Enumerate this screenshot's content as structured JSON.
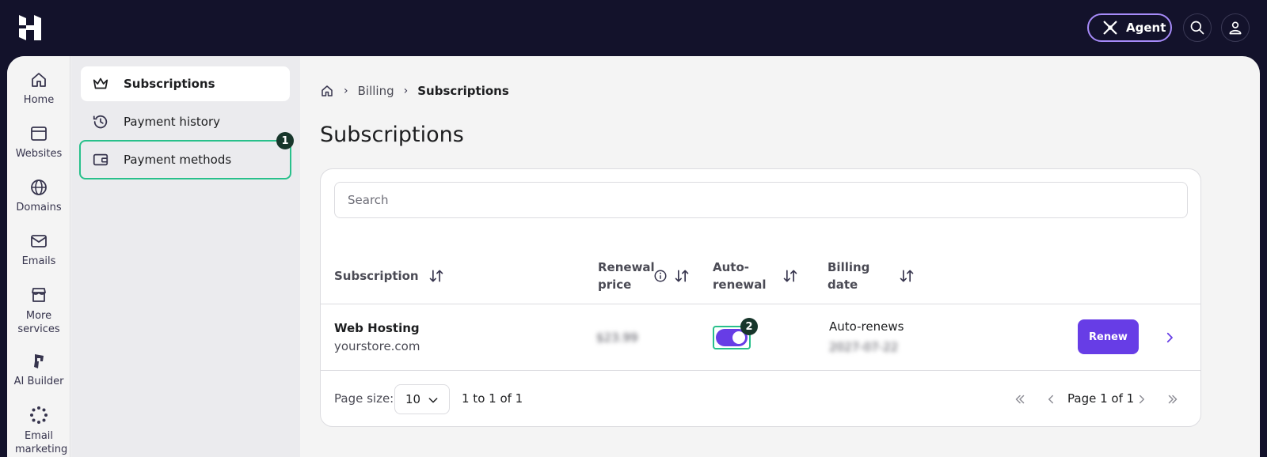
{
  "topbar": {
    "agent_label": "Agent"
  },
  "rail": {
    "items": [
      {
        "label": "Home"
      },
      {
        "label": "Websites"
      },
      {
        "label": "Domains"
      },
      {
        "label": "Emails"
      },
      {
        "label": "More services"
      },
      {
        "label": "AI Builder"
      },
      {
        "label": "Email marketing"
      }
    ]
  },
  "submenu": {
    "items": [
      {
        "label": "Subscriptions",
        "active": true
      },
      {
        "label": "Payment history"
      },
      {
        "label": "Payment methods",
        "badge": "1"
      }
    ]
  },
  "breadcrumb": {
    "items": [
      "Billing",
      "Subscriptions"
    ]
  },
  "page": {
    "title": "Subscriptions"
  },
  "table": {
    "search_placeholder": "Search",
    "headers": {
      "subscription": "Subscription",
      "renewal_price_1": "Renewal",
      "renewal_price_2": "price",
      "auto_renewal_1": "Auto-",
      "auto_renewal_2": "renewal",
      "billing_date_1": "Billing",
      "billing_date_2": "date"
    },
    "rows": [
      {
        "name": "Web Hosting",
        "domain": "yourstore.com",
        "price": "$23.99",
        "auto_renewal": true,
        "toggle_badge": "2",
        "billing_status": "Auto-renews",
        "billing_date": "2027-07-22",
        "action_label": "Renew"
      }
    ],
    "footer": {
      "page_size_label": "Page size:",
      "page_size_value": "10",
      "range_text": "1 to 1 of 1",
      "page_text": "Page 1 of 1"
    }
  },
  "colors": {
    "accent": "#673de6",
    "highlight": "#28c08b",
    "topbar_bg": "#13122b"
  }
}
